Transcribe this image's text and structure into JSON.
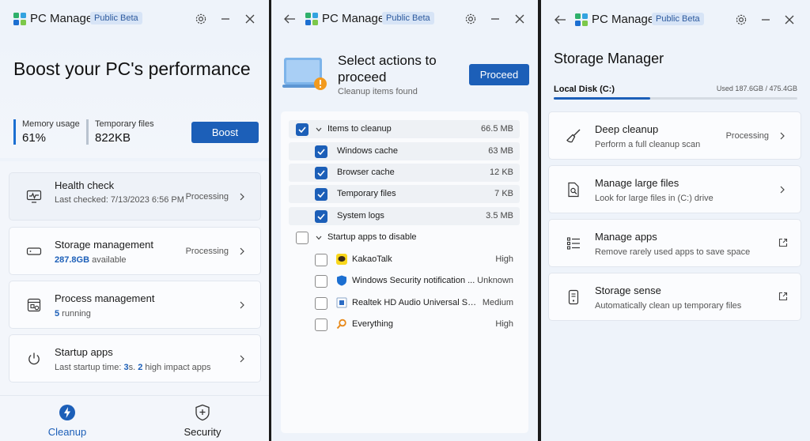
{
  "app": {
    "title": "PC Manager",
    "badge": "Public Beta"
  },
  "colors": {
    "accent": "#1c5fb8",
    "window_bg": "#eef3fa",
    "card_bg": "#fbfcfe"
  },
  "home": {
    "heading": "Boost your PC's performance",
    "stats": [
      {
        "label": "Memory usage",
        "value": "61%"
      },
      {
        "label": "Temporary files",
        "value": "822KB"
      }
    ],
    "boost_label": "Boost",
    "cards": [
      {
        "title": "Health check",
        "subtitle": "Last checked: 7/13/2023 6:56 PM",
        "status": "Processing",
        "icon": "health-monitor-icon"
      },
      {
        "title": "Storage management",
        "subtitle_value": "287.8GB",
        "subtitle_text": " available",
        "status": "Processing",
        "icon": "storage-drive-icon"
      },
      {
        "title": "Process management",
        "subtitle_value": "5",
        "subtitle_text": " running",
        "status": "",
        "icon": "process-window-icon"
      },
      {
        "title": "Startup apps",
        "subtitle_prefix": "Last startup time: ",
        "subtitle_value1": "3",
        "subtitle_mid": "s. ",
        "subtitle_value2": "2",
        "subtitle_suffix": " high impact apps",
        "status": "",
        "icon": "power-icon"
      }
    ],
    "nav": [
      {
        "label": "Cleanup",
        "icon": "lightning-icon",
        "active": true
      },
      {
        "label": "Security",
        "icon": "shield-icon",
        "active": false
      }
    ]
  },
  "cleanup": {
    "title": "Select actions to proceed",
    "subtitle": "Cleanup items found",
    "proceed_label": "Proceed",
    "groups": [
      {
        "label": "Items to cleanup",
        "value": "66.5 MB",
        "checked": true,
        "items": [
          {
            "label": "Windows cache",
            "value": "63 MB",
            "checked": true
          },
          {
            "label": "Browser cache",
            "value": "12 KB",
            "checked": true
          },
          {
            "label": "Temporary files",
            "value": "7 KB",
            "checked": true
          },
          {
            "label": "System logs",
            "value": "3.5 MB",
            "checked": true
          }
        ]
      },
      {
        "label": "Startup apps to disable",
        "value": "",
        "checked": false,
        "items": [
          {
            "label": "KakaoTalk",
            "value": "High",
            "checked": false,
            "icon": "kakaotalk-icon"
          },
          {
            "label": "Windows Security notification ...",
            "value": "Unknown",
            "checked": false,
            "icon": "windows-security-icon"
          },
          {
            "label": "Realtek HD Audio Universal Se...",
            "value": "Medium",
            "checked": false,
            "icon": "realtek-audio-icon"
          },
          {
            "label": "Everything",
            "value": "High",
            "checked": false,
            "icon": "everything-search-icon"
          }
        ]
      }
    ]
  },
  "storage": {
    "title": "Storage Manager",
    "disk_label": "Local Disk (C:)",
    "disk_used": "Used 187.6GB / 475.4GB",
    "disk_fraction": 0.3946,
    "cards": [
      {
        "title": "Deep cleanup",
        "subtitle": "Perform a full cleanup scan",
        "status": "Processing",
        "icon": "broom-icon",
        "action": "chevron"
      },
      {
        "title": "Manage large files",
        "subtitle": "Look for large files in (C:) drive",
        "status": "",
        "icon": "file-search-icon",
        "action": "chevron"
      },
      {
        "title": "Manage apps",
        "subtitle": "Remove rarely used apps to save space",
        "status": "",
        "icon": "app-list-icon",
        "action": "external"
      },
      {
        "title": "Storage sense",
        "subtitle": "Automatically clean up temporary files",
        "status": "",
        "icon": "storage-sense-icon",
        "action": "external"
      }
    ]
  }
}
